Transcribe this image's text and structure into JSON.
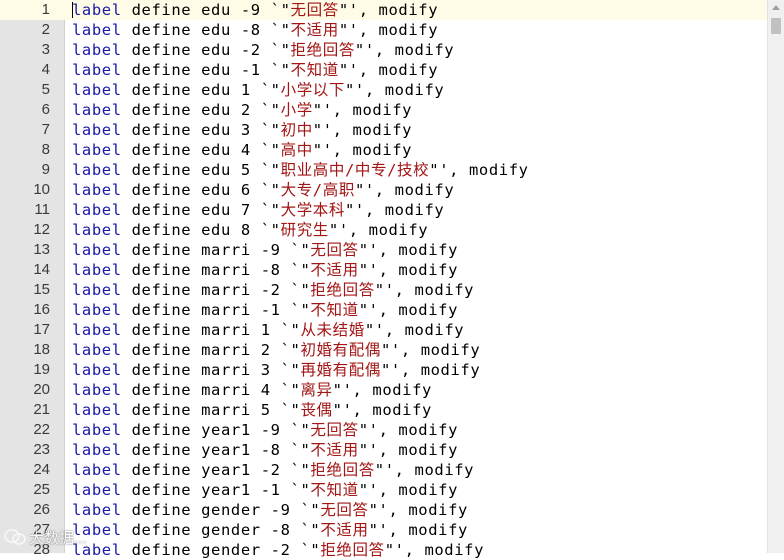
{
  "editor": {
    "current_line": 1,
    "lines": [
      {
        "n": "1",
        "kw": "label",
        "mid": " define edu -9 `\"",
        "str": "无回答",
        "tail": "\"', modify"
      },
      {
        "n": "2",
        "kw": "label",
        "mid": " define edu -8 `\"",
        "str": "不适用",
        "tail": "\"', modify"
      },
      {
        "n": "3",
        "kw": "label",
        "mid": " define edu -2 `\"",
        "str": "拒绝回答",
        "tail": "\"', modify"
      },
      {
        "n": "4",
        "kw": "label",
        "mid": " define edu -1 `\"",
        "str": "不知道",
        "tail": "\"', modify"
      },
      {
        "n": "5",
        "kw": "label",
        "mid": " define edu 1 `\"",
        "str": "小学以下",
        "tail": "\"', modify"
      },
      {
        "n": "6",
        "kw": "label",
        "mid": " define edu 2 `\"",
        "str": "小学",
        "tail": "\"', modify"
      },
      {
        "n": "7",
        "kw": "label",
        "mid": " define edu 3 `\"",
        "str": "初中",
        "tail": "\"', modify"
      },
      {
        "n": "8",
        "kw": "label",
        "mid": " define edu 4 `\"",
        "str": "高中",
        "tail": "\"', modify"
      },
      {
        "n": "9",
        "kw": "label",
        "mid": " define edu 5 `\"",
        "str": "职业高中/中专/技校",
        "tail": "\"', modify"
      },
      {
        "n": "10",
        "kw": "label",
        "mid": " define edu 6 `\"",
        "str": "大专/高职",
        "tail": "\"', modify"
      },
      {
        "n": "11",
        "kw": "label",
        "mid": " define edu 7 `\"",
        "str": "大学本科",
        "tail": "\"', modify"
      },
      {
        "n": "12",
        "kw": "label",
        "mid": " define edu 8 `\"",
        "str": "研究生",
        "tail": "\"', modify"
      },
      {
        "n": "13",
        "kw": "label",
        "mid": " define marri -9 `\"",
        "str": "无回答",
        "tail": "\"', modify"
      },
      {
        "n": "14",
        "kw": "label",
        "mid": " define marri -8 `\"",
        "str": "不适用",
        "tail": "\"', modify"
      },
      {
        "n": "15",
        "kw": "label",
        "mid": " define marri -2 `\"",
        "str": "拒绝回答",
        "tail": "\"', modify"
      },
      {
        "n": "16",
        "kw": "label",
        "mid": " define marri -1 `\"",
        "str": "不知道",
        "tail": "\"', modify"
      },
      {
        "n": "17",
        "kw": "label",
        "mid": " define marri 1 `\"",
        "str": "从未结婚",
        "tail": "\"', modify"
      },
      {
        "n": "18",
        "kw": "label",
        "mid": " define marri 2 `\"",
        "str": "初婚有配偶",
        "tail": "\"', modify"
      },
      {
        "n": "19",
        "kw": "label",
        "mid": " define marri 3 `\"",
        "str": "再婚有配偶",
        "tail": "\"', modify"
      },
      {
        "n": "20",
        "kw": "label",
        "mid": " define marri 4 `\"",
        "str": "离异",
        "tail": "\"', modify"
      },
      {
        "n": "21",
        "kw": "label",
        "mid": " define marri 5 `\"",
        "str": "丧偶",
        "tail": "\"', modify"
      },
      {
        "n": "22",
        "kw": "label",
        "mid": " define year1 -9 `\"",
        "str": "无回答",
        "tail": "\"', modify"
      },
      {
        "n": "23",
        "kw": "label",
        "mid": " define year1 -8 `\"",
        "str": "不适用",
        "tail": "\"', modify"
      },
      {
        "n": "24",
        "kw": "label",
        "mid": " define year1 -2 `\"",
        "str": "拒绝回答",
        "tail": "\"', modify"
      },
      {
        "n": "25",
        "kw": "label",
        "mid": " define year1 -1 `\"",
        "str": "不知道",
        "tail": "\"', modify"
      },
      {
        "n": "26",
        "kw": "label",
        "mid": " define gender -9 `\"",
        "str": "无回答",
        "tail": "\"', modify"
      },
      {
        "n": "27",
        "kw": "label",
        "mid": " define gender -8 `\"",
        "str": "不适用",
        "tail": "\"', modify"
      },
      {
        "n": "28",
        "kw": "label",
        "mid": " define gender -2 `\"",
        "str": "拒绝回答",
        "tail": "\"', modify"
      }
    ]
  },
  "watermark": {
    "icon": "wechat-logo-icon",
    "text": "大数据..."
  },
  "colors": {
    "keyword": "#1a1aa6",
    "string": "#a31515",
    "gutter": "#e4e4e4",
    "current_line": "#fefbe6"
  }
}
